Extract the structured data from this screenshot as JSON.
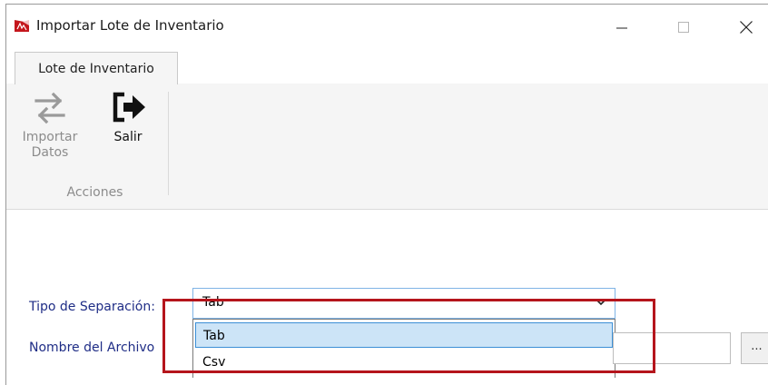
{
  "window": {
    "title": "Importar Lote de Inventario",
    "icon": "app-icon",
    "controls": {
      "minimize": "—",
      "maximize": "☐",
      "close": "✕"
    }
  },
  "ribbon": {
    "tabs": [
      {
        "label": "Lote de Inventario",
        "active": true
      }
    ],
    "groups": [
      {
        "label": "Acciones",
        "buttons": [
          {
            "label": "Importar Datos",
            "icon": "swap-arrows-icon",
            "enabled": false
          },
          {
            "label": "Salir",
            "icon": "exit-icon",
            "enabled": true
          }
        ]
      }
    ]
  },
  "form": {
    "separation_label": "Tipo de Separación:",
    "separation_value": "Tab",
    "separation_options": [
      "Tab",
      "Csv"
    ],
    "filename_label": "Nombre del Archivo",
    "filename_value": "",
    "browse_label": "..."
  },
  "colors": {
    "label": "#1f2d86",
    "highlight": "#b5151c",
    "selected_bg": "#cce4f7",
    "selected_border": "#3c8fd6"
  }
}
